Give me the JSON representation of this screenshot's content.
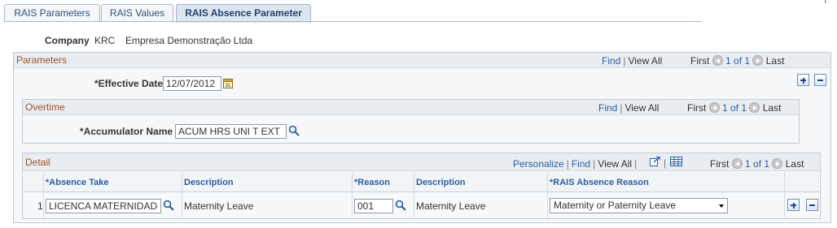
{
  "tabs": [
    {
      "label": "RAIS Parameters",
      "accesskey": "R",
      "rest": "AIS Parameters"
    },
    {
      "label": "RAIS Values",
      "accesskey": "R",
      "rest": "AIS Values"
    },
    {
      "label": "RAIS Absence Parameter"
    }
  ],
  "company": {
    "label": "Company",
    "code": "KRC",
    "name": "Empresa Demonstração Ltda"
  },
  "parameters": {
    "title": "Parameters",
    "nav": {
      "find": "Find",
      "view_all": "View All",
      "first": "First",
      "count": "1 of 1",
      "last": "Last"
    },
    "effective_date_label": "*Effective Date",
    "effective_date": "12/07/2012"
  },
  "overtime": {
    "title": "Overtime",
    "nav": {
      "find": "Find",
      "view_all": "View All",
      "first": "First",
      "count": "1 of 1",
      "last": "Last"
    },
    "accumulator_label": "*Accumulator Name",
    "accumulator_value": "ACUM HRS UNI T EXT"
  },
  "detail": {
    "title": "Detail",
    "nav": {
      "personalize": "Personalize",
      "find": "Find",
      "view_all": "View All",
      "first": "First",
      "count": "1 of 1",
      "last": "Last"
    },
    "columns": [
      "*Absence Take",
      "Description",
      "*Reason",
      "Description",
      "*RAIS Absence Reason"
    ],
    "rows": [
      {
        "num": "1",
        "absence_take": "LICENCA MATERNIDAD",
        "description": "Maternity Leave",
        "reason": "001",
        "reason_description": "Maternity Leave",
        "rais_reason": "Maternity or Paternity Leave"
      }
    ]
  },
  "icon_color": "#2d5d9f",
  "group_title_color": "#a0522d"
}
